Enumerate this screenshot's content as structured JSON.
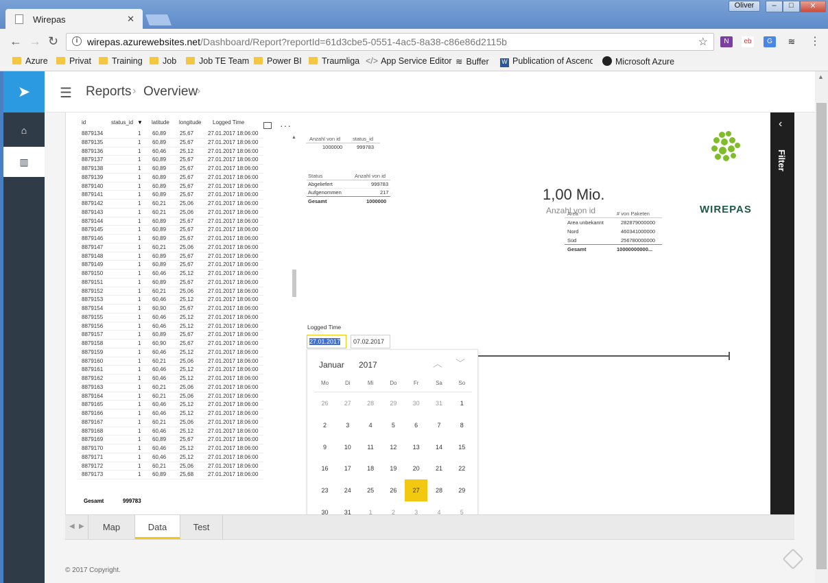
{
  "browser": {
    "tab_title": "Wirepas",
    "user": "Oliver",
    "url_domain": "wirepas.azurewebsites.net",
    "url_path": "/Dashboard/Report?reportId=61d3cbe5-0551-4ac5-8a38-c86e86d2115b",
    "bookmarks": [
      "Azure",
      "Privat",
      "Training",
      "Job",
      "Job TE Team",
      "Power BI",
      "Traumliga",
      "App Service Editor",
      "Buffer",
      "Publication of Ascend",
      "Microsoft Azure"
    ]
  },
  "header": {
    "crumb1": "Reports",
    "crumb2": "Overview"
  },
  "table": {
    "headers": [
      "id",
      "status_id",
      "latitude",
      "longitude",
      "Logged Time"
    ],
    "rows": [
      [
        "8879134",
        "1",
        "60,89",
        "25,67",
        "27.01.2017 18:06:00"
      ],
      [
        "8879135",
        "1",
        "60,89",
        "25,67",
        "27.01.2017 18:06:00"
      ],
      [
        "8879136",
        "1",
        "60,46",
        "25,12",
        "27.01.2017 18:06:00"
      ],
      [
        "8879137",
        "1",
        "60,89",
        "25,67",
        "27.01.2017 18:06:00"
      ],
      [
        "8879138",
        "1",
        "60,89",
        "25,67",
        "27.01.2017 18:06:00"
      ],
      [
        "8879139",
        "1",
        "60,89",
        "25,67",
        "27.01.2017 18:06:00"
      ],
      [
        "8879140",
        "1",
        "60,89",
        "25,67",
        "27.01.2017 18:06:00"
      ],
      [
        "8879141",
        "1",
        "60,89",
        "25,67",
        "27.01.2017 18:06:00"
      ],
      [
        "8879142",
        "1",
        "60,21",
        "25,06",
        "27.01.2017 18:06:00"
      ],
      [
        "8879143",
        "1",
        "60,21",
        "25,06",
        "27.01.2017 18:06:00"
      ],
      [
        "8879144",
        "1",
        "60,89",
        "25,67",
        "27.01.2017 18:06:00"
      ],
      [
        "8879145",
        "1",
        "60,89",
        "25,67",
        "27.01.2017 18:06:00"
      ],
      [
        "8879146",
        "1",
        "60,89",
        "25,67",
        "27.01.2017 18:06:00"
      ],
      [
        "8879147",
        "1",
        "60,21",
        "25,06",
        "27.01.2017 18:06:00"
      ],
      [
        "8879148",
        "1",
        "60,89",
        "25,67",
        "27.01.2017 18:06:00"
      ],
      [
        "8879149",
        "1",
        "60,89",
        "25,67",
        "27.01.2017 18:06:00"
      ],
      [
        "8879150",
        "1",
        "60,46",
        "25,12",
        "27.01.2017 18:06:00"
      ],
      [
        "8879151",
        "1",
        "60,89",
        "25,67",
        "27.01.2017 18:06:00"
      ],
      [
        "8879152",
        "1",
        "60,21",
        "25,06",
        "27.01.2017 18:06:00"
      ],
      [
        "8879153",
        "1",
        "60,46",
        "25,12",
        "27.01.2017 18:06:00"
      ],
      [
        "8879154",
        "1",
        "60,90",
        "25,67",
        "27.01.2017 18:06:00"
      ],
      [
        "8879155",
        "1",
        "60,46",
        "25,12",
        "27.01.2017 18:06:00"
      ],
      [
        "8879156",
        "1",
        "60,46",
        "25,12",
        "27.01.2017 18:06:00"
      ],
      [
        "8879157",
        "1",
        "60,89",
        "25,67",
        "27.01.2017 18:06:00"
      ],
      [
        "8879158",
        "1",
        "60,90",
        "25,67",
        "27.01.2017 18:06:00"
      ],
      [
        "8879159",
        "1",
        "60,46",
        "25,12",
        "27.01.2017 18:06:00"
      ],
      [
        "8879160",
        "1",
        "60,21",
        "25,06",
        "27.01.2017 18:06:00"
      ],
      [
        "8879161",
        "1",
        "60,46",
        "25,12",
        "27.01.2017 18:06:00"
      ],
      [
        "8879162",
        "1",
        "60,46",
        "25,12",
        "27.01.2017 18:06:00"
      ],
      [
        "8879163",
        "1",
        "60,21",
        "25,06",
        "27.01.2017 18:06:00"
      ],
      [
        "8879164",
        "1",
        "60,21",
        "25,06",
        "27.01.2017 18:06:00"
      ],
      [
        "8879165",
        "1",
        "60,46",
        "25,12",
        "27.01.2017 18:06:00"
      ],
      [
        "8879166",
        "1",
        "60,46",
        "25,12",
        "27.01.2017 18:06:00"
      ],
      [
        "8879167",
        "1",
        "60,21",
        "25,06",
        "27.01.2017 18:06:00"
      ],
      [
        "8879168",
        "1",
        "60,46",
        "25,12",
        "27.01.2017 18:06:00"
      ],
      [
        "8879169",
        "1",
        "60,89",
        "25,67",
        "27.01.2017 18:06:00"
      ],
      [
        "8879170",
        "1",
        "60,46",
        "25,12",
        "27.01.2017 18:06:00"
      ],
      [
        "8879171",
        "1",
        "60,46",
        "25,12",
        "27.01.2017 18:06:00"
      ],
      [
        "8879172",
        "1",
        "60,21",
        "25,06",
        "27.01.2017 18:06:00"
      ],
      [
        "8879173",
        "1",
        "60,89",
        "25,68",
        "27.01.2017 18:06:00"
      ]
    ],
    "total_label": "Gesamt",
    "total_value": "999783"
  },
  "card_table": {
    "headers": [
      "Anzahl von id",
      "status_id"
    ],
    "row": [
      "1000000",
      "999783"
    ]
  },
  "status_table": {
    "headers": [
      "Status",
      "Anzahl von id"
    ],
    "rows": [
      [
        "Abgeliefert",
        "999783"
      ],
      [
        "Aufgenommen",
        "217"
      ]
    ],
    "total": [
      "Gesamt",
      "1000000"
    ]
  },
  "kpi": {
    "value": "1,00 Mio.",
    "label": "Anzahl von id"
  },
  "logo": {
    "text": "WIREPAS"
  },
  "area_table": {
    "headers": [
      "Area",
      "# von Paketen"
    ],
    "rows": [
      [
        "Area unbekannt",
        "282879000000"
      ],
      [
        "Nord",
        "460341000000"
      ],
      [
        "Süd",
        "256780000000"
      ]
    ],
    "total": [
      "Gesamt",
      "10000000000..."
    ]
  },
  "slicer": {
    "title": "Logged Time",
    "from": "27.01.2017",
    "to": "07.02.2017"
  },
  "calendar": {
    "month": "Januar",
    "year": "2017",
    "weekdays": [
      "Mo",
      "Di",
      "Mi",
      "Do",
      "Fr",
      "Sa",
      "So"
    ],
    "days": [
      [
        "26",
        "27",
        "28",
        "29",
        "30",
        "31",
        "1"
      ],
      [
        "2",
        "3",
        "4",
        "5",
        "6",
        "7",
        "8"
      ],
      [
        "9",
        "10",
        "11",
        "12",
        "13",
        "14",
        "15"
      ],
      [
        "16",
        "17",
        "18",
        "19",
        "20",
        "21",
        "22"
      ],
      [
        "23",
        "24",
        "25",
        "26",
        "27",
        "28",
        "29"
      ],
      [
        "30",
        "31",
        "1",
        "2",
        "3",
        "4",
        "5"
      ]
    ],
    "selected": "27"
  },
  "filter": {
    "label": "Filter"
  },
  "pages": [
    "Map",
    "Data",
    "Test"
  ],
  "active_page": "Data",
  "footer": "© 2017 Copyright."
}
